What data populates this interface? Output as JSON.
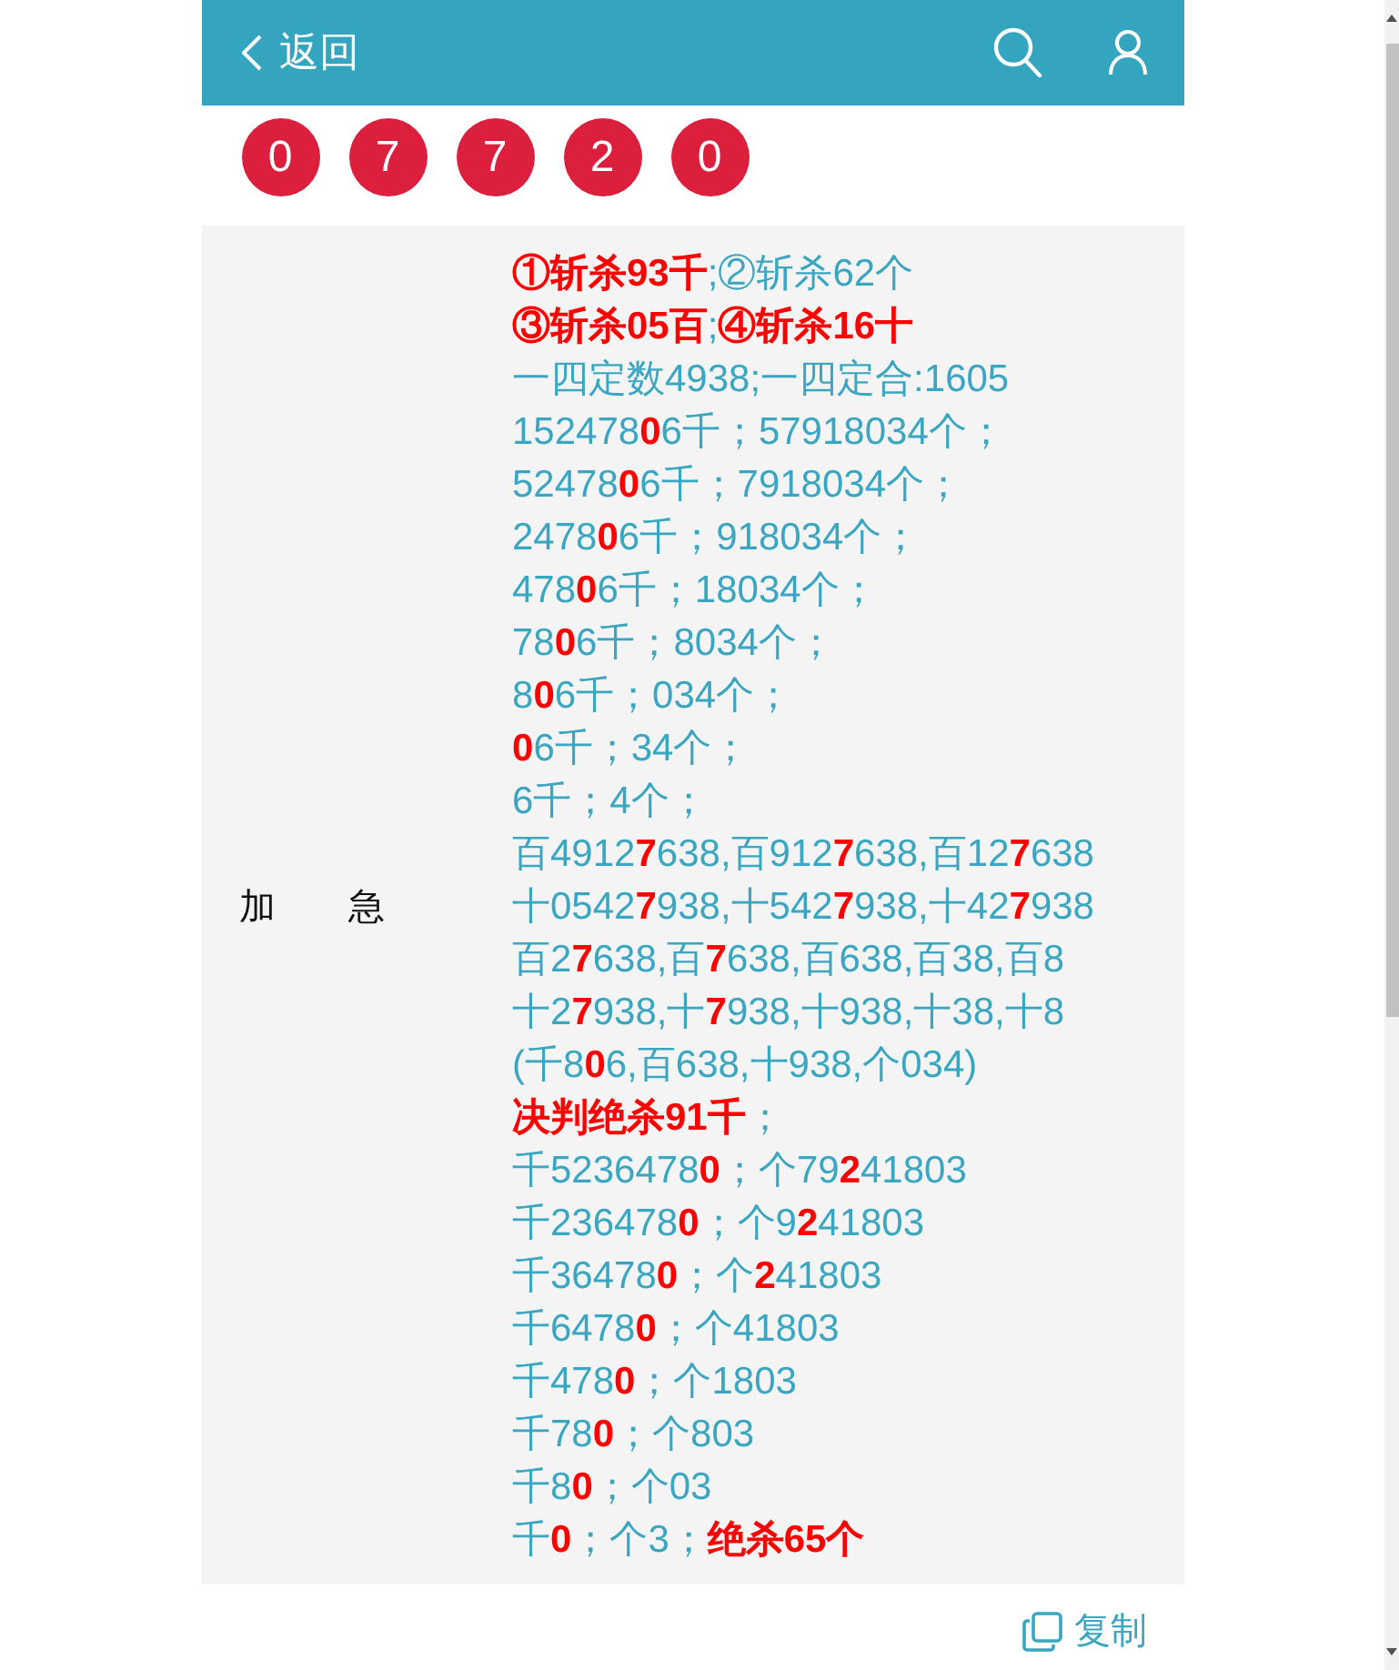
{
  "header": {
    "back_label": "返回"
  },
  "balls": [
    "0",
    "7",
    "7",
    "2",
    "0"
  ],
  "panel": {
    "label": "加　　急",
    "lines": [
      {
        "segments": [
          {
            "text": "①斩杀93千",
            "highlight": true
          },
          {
            "text": ";②斩杀62个",
            "highlight": false
          }
        ]
      },
      {
        "segments": [
          {
            "text": "③斩杀05百",
            "highlight": true
          },
          {
            "text": ";",
            "highlight": false
          },
          {
            "text": "④斩杀16十",
            "highlight": true
          }
        ]
      },
      {
        "segments": [
          {
            "text": "一四定数4938;一四定合:1605",
            "highlight": false
          }
        ]
      },
      {
        "segments": [
          {
            "text": "152478",
            "highlight": false
          },
          {
            "text": "0",
            "highlight": true
          },
          {
            "text": "6千；57918034个；",
            "highlight": false
          }
        ]
      },
      {
        "segments": [
          {
            "text": "52478",
            "highlight": false
          },
          {
            "text": "0",
            "highlight": true
          },
          {
            "text": "6千；7918034个；",
            "highlight": false
          }
        ]
      },
      {
        "segments": [
          {
            "text": "2478",
            "highlight": false
          },
          {
            "text": "0",
            "highlight": true
          },
          {
            "text": "6千；918034个；",
            "highlight": false
          }
        ]
      },
      {
        "segments": [
          {
            "text": "478",
            "highlight": false
          },
          {
            "text": "0",
            "highlight": true
          },
          {
            "text": "6千；18034个；",
            "highlight": false
          }
        ]
      },
      {
        "segments": [
          {
            "text": "78",
            "highlight": false
          },
          {
            "text": "0",
            "highlight": true
          },
          {
            "text": "6千；8034个；",
            "highlight": false
          }
        ]
      },
      {
        "segments": [
          {
            "text": "8",
            "highlight": false
          },
          {
            "text": "0",
            "highlight": true
          },
          {
            "text": "6千；034个；",
            "highlight": false
          }
        ]
      },
      {
        "segments": [
          {
            "text": "0",
            "highlight": true
          },
          {
            "text": "6千；34个；",
            "highlight": false
          }
        ]
      },
      {
        "segments": [
          {
            "text": "6千；4个；",
            "highlight": false
          }
        ]
      },
      {
        "segments": [
          {
            "text": "百4912",
            "highlight": false
          },
          {
            "text": "7",
            "highlight": true
          },
          {
            "text": "638,百912",
            "highlight": false
          },
          {
            "text": "7",
            "highlight": true
          },
          {
            "text": "638,百12",
            "highlight": false
          },
          {
            "text": "7",
            "highlight": true
          },
          {
            "text": "638",
            "highlight": false
          }
        ]
      },
      {
        "segments": [
          {
            "text": "十0542",
            "highlight": false
          },
          {
            "text": "7",
            "highlight": true
          },
          {
            "text": "938,十542",
            "highlight": false
          },
          {
            "text": "7",
            "highlight": true
          },
          {
            "text": "938,十42",
            "highlight": false
          },
          {
            "text": "7",
            "highlight": true
          },
          {
            "text": "938",
            "highlight": false
          }
        ]
      },
      {
        "segments": [
          {
            "text": "百2",
            "highlight": false
          },
          {
            "text": "7",
            "highlight": true
          },
          {
            "text": "638,百",
            "highlight": false
          },
          {
            "text": "7",
            "highlight": true
          },
          {
            "text": "638,百638,百38,百8",
            "highlight": false
          }
        ]
      },
      {
        "segments": [
          {
            "text": "十2",
            "highlight": false
          },
          {
            "text": "7",
            "highlight": true
          },
          {
            "text": "938,十",
            "highlight": false
          },
          {
            "text": "7",
            "highlight": true
          },
          {
            "text": "938,十938,十38,十8",
            "highlight": false
          }
        ]
      },
      {
        "segments": [
          {
            "text": "(千8",
            "highlight": false
          },
          {
            "text": "0",
            "highlight": true
          },
          {
            "text": "6,百638,十938,个034)",
            "highlight": false
          }
        ]
      },
      {
        "segments": [
          {
            "text": "决判绝杀91千",
            "highlight": true
          },
          {
            "text": "；",
            "highlight": false
          }
        ]
      },
      {
        "segments": [
          {
            "text": "千5236478",
            "highlight": false
          },
          {
            "text": "0",
            "highlight": true
          },
          {
            "text": "；个79",
            "highlight": false
          },
          {
            "text": "2",
            "highlight": true
          },
          {
            "text": "41803",
            "highlight": false
          }
        ]
      },
      {
        "segments": [
          {
            "text": "千236478",
            "highlight": false
          },
          {
            "text": "0",
            "highlight": true
          },
          {
            "text": "；个9",
            "highlight": false
          },
          {
            "text": "2",
            "highlight": true
          },
          {
            "text": "41803",
            "highlight": false
          }
        ]
      },
      {
        "segments": [
          {
            "text": "千36478",
            "highlight": false
          },
          {
            "text": "0",
            "highlight": true
          },
          {
            "text": "；个",
            "highlight": false
          },
          {
            "text": "2",
            "highlight": true
          },
          {
            "text": "41803",
            "highlight": false
          }
        ]
      },
      {
        "segments": [
          {
            "text": "千6478",
            "highlight": false
          },
          {
            "text": "0",
            "highlight": true
          },
          {
            "text": "；个41803",
            "highlight": false
          }
        ]
      },
      {
        "segments": [
          {
            "text": "千478",
            "highlight": false
          },
          {
            "text": "0",
            "highlight": true
          },
          {
            "text": "；个1803",
            "highlight": false
          }
        ]
      },
      {
        "segments": [
          {
            "text": "千78",
            "highlight": false
          },
          {
            "text": "0",
            "highlight": true
          },
          {
            "text": "；个803",
            "highlight": false
          }
        ]
      },
      {
        "segments": [
          {
            "text": "千8",
            "highlight": false
          },
          {
            "text": "0",
            "highlight": true
          },
          {
            "text": "；个03",
            "highlight": false
          }
        ]
      },
      {
        "segments": [
          {
            "text": "千",
            "highlight": false
          },
          {
            "text": "0",
            "highlight": true
          },
          {
            "text": "；个3；",
            "highlight": false
          },
          {
            "text": "绝杀65个",
            "highlight": true
          }
        ]
      }
    ]
  },
  "copy_button": {
    "label": "复制"
  }
}
